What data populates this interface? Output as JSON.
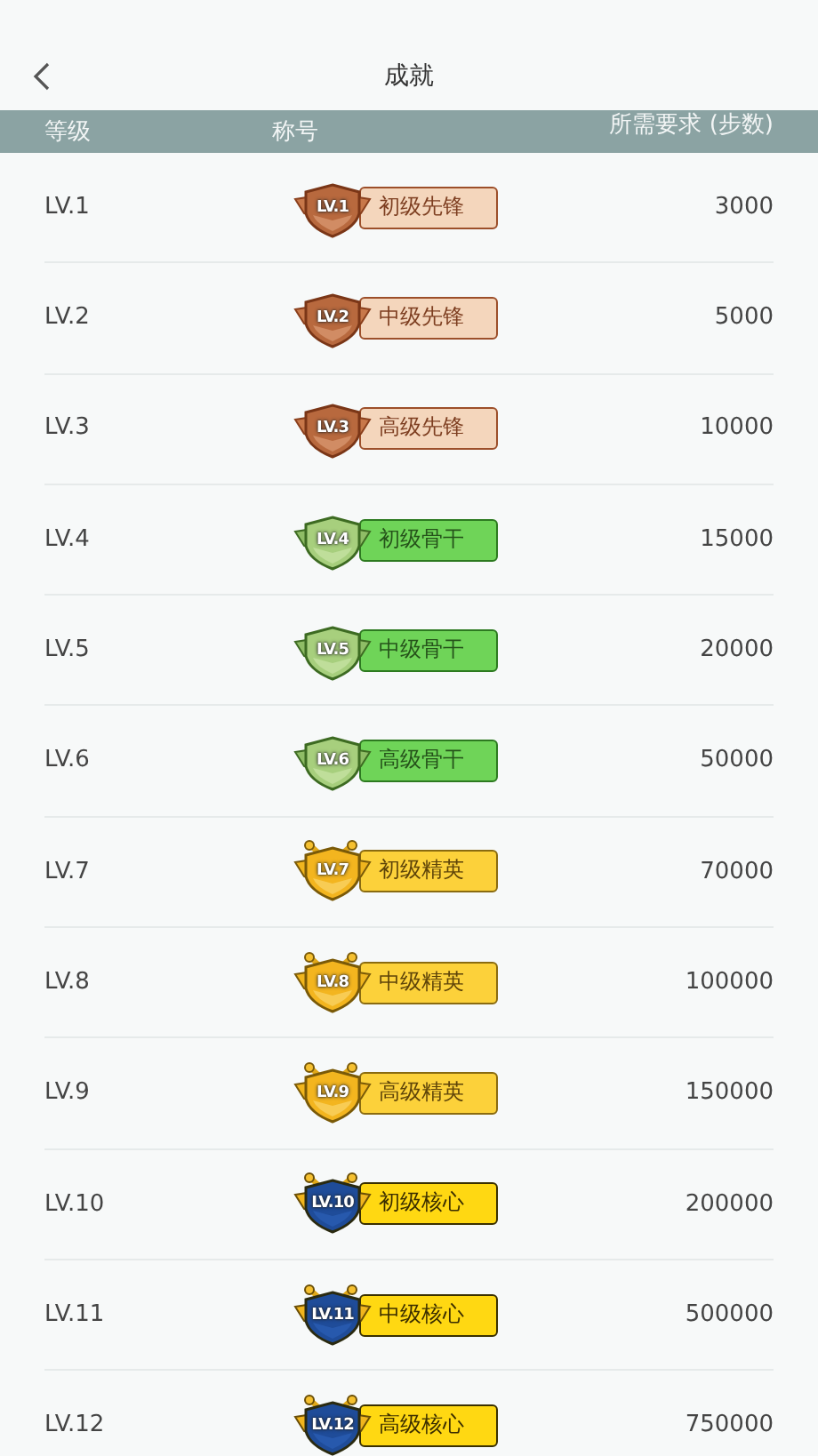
{
  "header": {
    "title": "成就"
  },
  "table": {
    "columns": [
      "等级",
      "称号",
      "所需要求 (步数)"
    ],
    "rows": [
      {
        "level": "LV.1",
        "badge": {
          "kind": "bronze",
          "level_text": "LV.1",
          "title": "初级先锋"
        },
        "requirement": "3000"
      },
      {
        "level": "LV.2",
        "badge": {
          "kind": "bronze",
          "level_text": "LV.2",
          "title": "中级先锋"
        },
        "requirement": "5000"
      },
      {
        "level": "LV.3",
        "badge": {
          "kind": "bronze",
          "level_text": "LV.3",
          "title": "高级先锋"
        },
        "requirement": "10000"
      },
      {
        "level": "LV.4",
        "badge": {
          "kind": "green",
          "level_text": "LV.4",
          "title": "初级骨干"
        },
        "requirement": "15000"
      },
      {
        "level": "LV.5",
        "badge": {
          "kind": "green",
          "level_text": "LV.5",
          "title": "中级骨干"
        },
        "requirement": "20000"
      },
      {
        "level": "LV.6",
        "badge": {
          "kind": "green",
          "level_text": "LV.6",
          "title": "高级骨干"
        },
        "requirement": "50000"
      },
      {
        "level": "LV.7",
        "badge": {
          "kind": "gold",
          "level_text": "LV.7",
          "title": "初级精英"
        },
        "requirement": "70000"
      },
      {
        "level": "LV.8",
        "badge": {
          "kind": "gold",
          "level_text": "LV.8",
          "title": "中级精英"
        },
        "requirement": "100000"
      },
      {
        "level": "LV.9",
        "badge": {
          "kind": "gold",
          "level_text": "LV.9",
          "title": "高级精英"
        },
        "requirement": "150000"
      },
      {
        "level": "LV.10",
        "badge": {
          "kind": "core",
          "level_text": "LV.10",
          "title": "初级核心"
        },
        "requirement": "200000"
      },
      {
        "level": "LV.11",
        "badge": {
          "kind": "core",
          "level_text": "LV.11",
          "title": "中级核心"
        },
        "requirement": "500000"
      },
      {
        "level": "LV.12",
        "badge": {
          "kind": "core",
          "level_text": "LV.12",
          "title": "高级核心"
        },
        "requirement": "750000"
      }
    ]
  }
}
